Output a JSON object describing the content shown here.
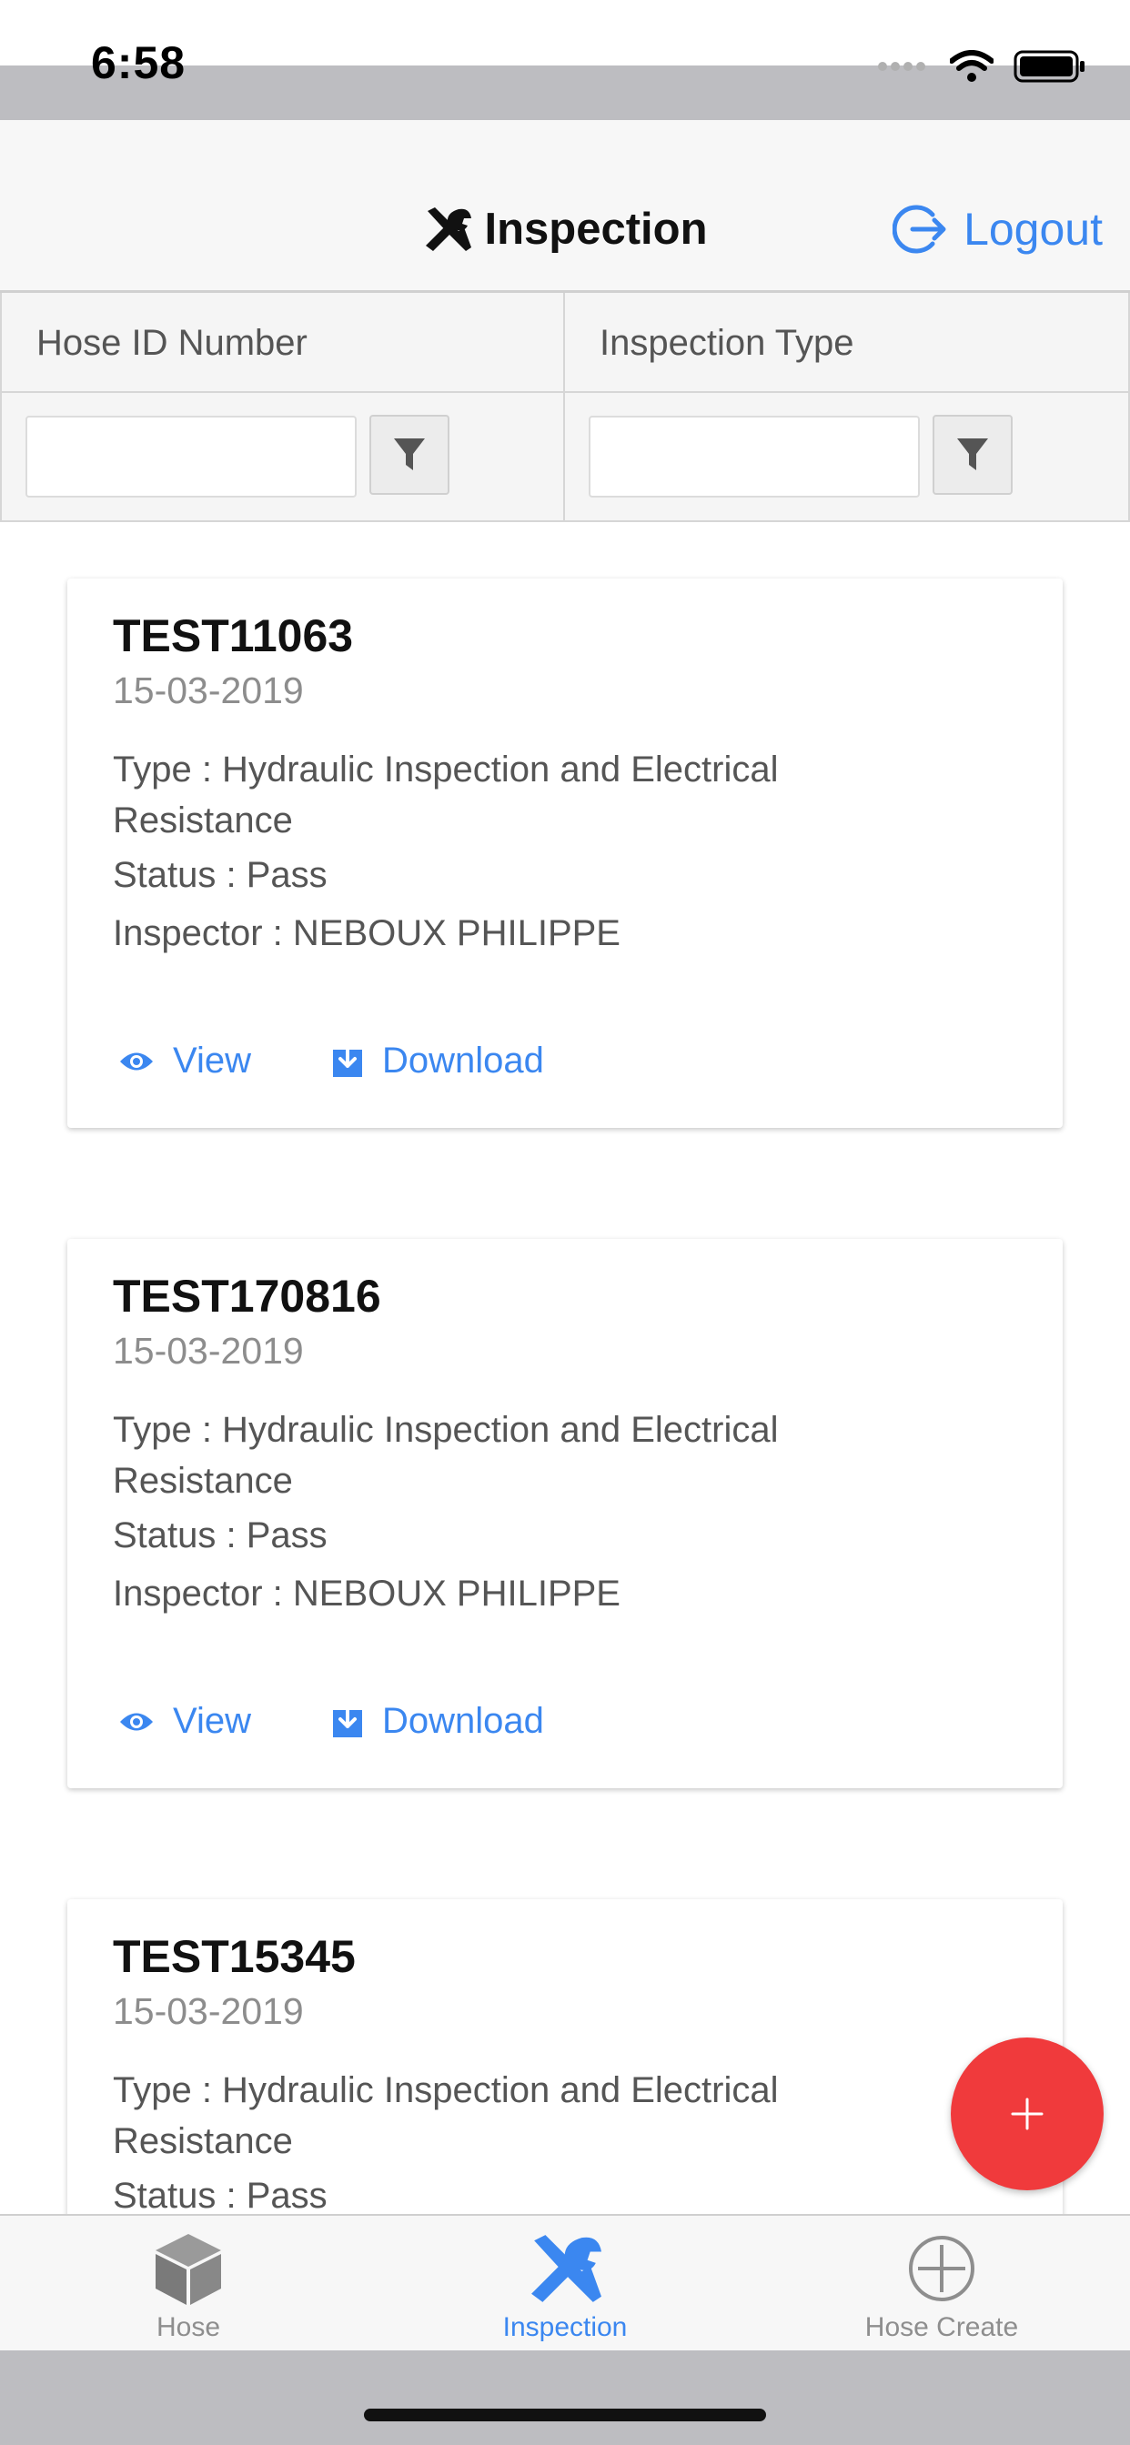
{
  "status_bar": {
    "time": "6:58"
  },
  "header": {
    "title": "Inspection",
    "logout_label": "Logout"
  },
  "filters": {
    "hose_id": {
      "label": "Hose ID Number",
      "value": ""
    },
    "inspection_type": {
      "label": "Inspection Type",
      "value": ""
    }
  },
  "inspections": [
    {
      "id": "TEST11063",
      "date": "15-03-2019",
      "type": "Type : Hydraulic Inspection and Electrical Resistance",
      "status": "Status : Pass",
      "inspector": "Inspector : NEBOUX PHILIPPE",
      "view_label": "View",
      "download_label": "Download"
    },
    {
      "id": "TEST170816",
      "date": "15-03-2019",
      "type": "Type : Hydraulic Inspection and Electrical Resistance",
      "status": "Status : Pass",
      "inspector": "Inspector : NEBOUX PHILIPPE",
      "view_label": "View",
      "download_label": "Download"
    },
    {
      "id": "TEST15345",
      "date": "15-03-2019",
      "type": "Type : Hydraulic Inspection and Electrical Resistance",
      "status": "Status : Pass",
      "inspector": "",
      "view_label": "",
      "download_label": ""
    }
  ],
  "fab": {
    "label": "+"
  },
  "tabs": [
    {
      "label": "Hose",
      "icon": "cube-icon"
    },
    {
      "label": "Inspection",
      "icon": "tools-icon",
      "active": true
    },
    {
      "label": "Hose Create",
      "icon": "plus-circle-icon"
    }
  ],
  "colors": {
    "accent": "#3b87f0",
    "fab": "#f03a3c"
  }
}
